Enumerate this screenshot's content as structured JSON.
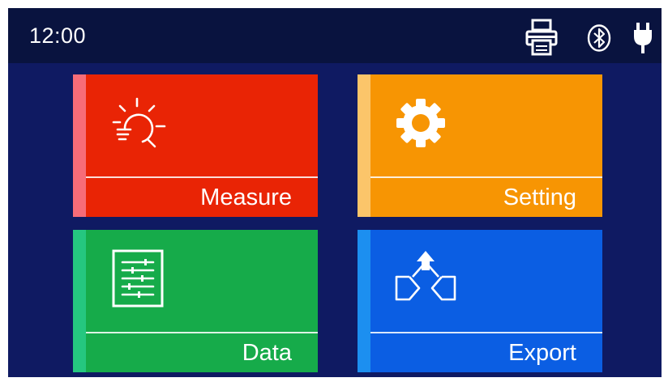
{
  "status_bar": {
    "time": "12:00",
    "icons": [
      "printer-icon",
      "bluetooth-icon",
      "power-plug-icon"
    ]
  },
  "tiles": [
    {
      "label": "Measure",
      "icon": "sun-light-icon",
      "color": "#e92405",
      "accent": "#f76c78"
    },
    {
      "label": "Setting",
      "icon": "gear-icon",
      "color": "#f79503",
      "accent": "#fbc56a"
    },
    {
      "label": "Data",
      "icon": "data-list-icon",
      "color": "#16ab4a",
      "accent": "#25c780"
    },
    {
      "label": "Export",
      "icon": "export-upload-icon",
      "color": "#0b5ee3",
      "accent": "#1c8ff0"
    }
  ],
  "colors": {
    "background": "#0f1a62",
    "status_bar": "#09133f",
    "text": "#ffffff"
  }
}
